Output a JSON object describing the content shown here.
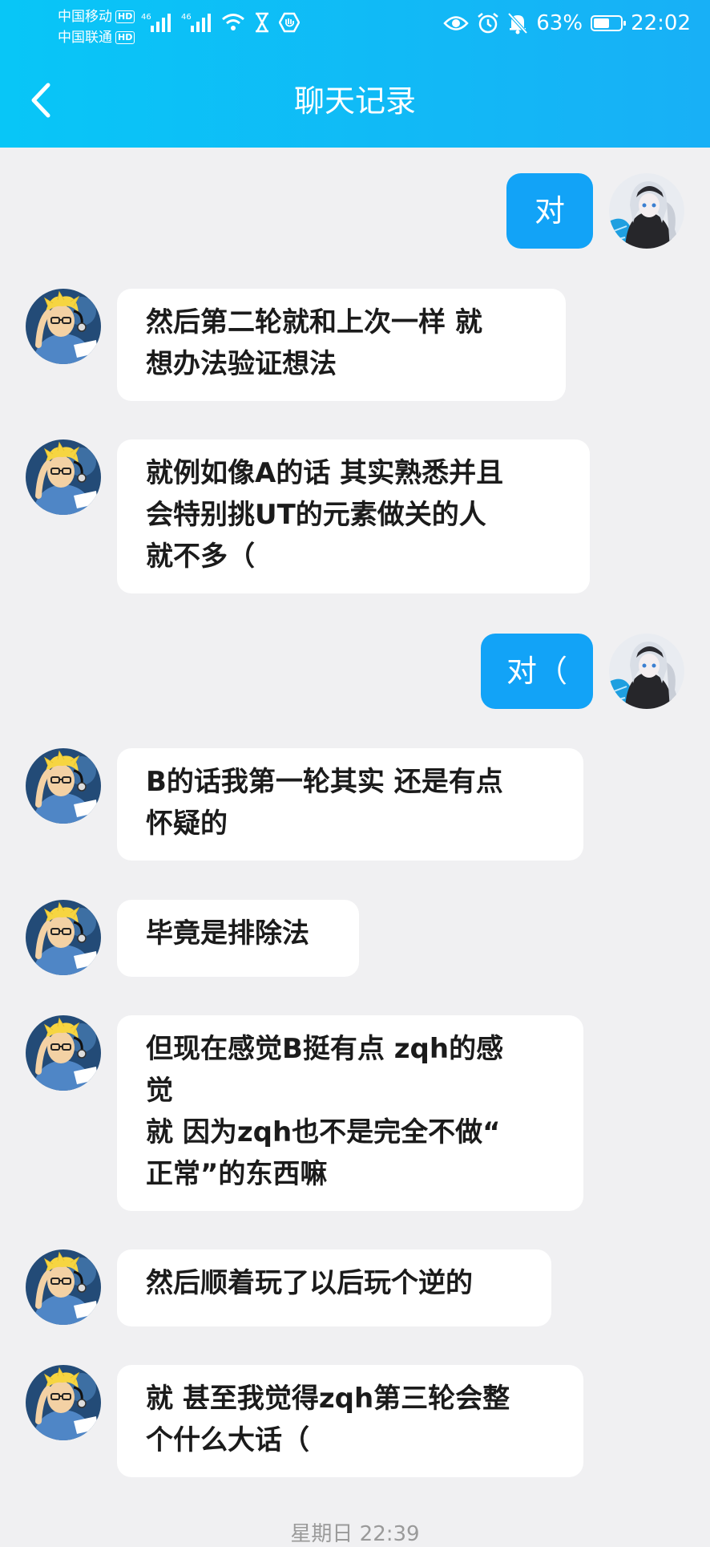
{
  "status_bar": {
    "carrier1": "中国移动",
    "carrier2": "中国联通",
    "hd": "HD",
    "net1": "46",
    "net2": "46",
    "battery_pct": "63%",
    "battery_level": 0.63,
    "time": "22:02"
  },
  "header": {
    "title": "聊天记录"
  },
  "colors": {
    "accent": "#12a3f7",
    "header": "#08c6f7"
  },
  "messages": [
    {
      "side": "right",
      "text": "对"
    },
    {
      "side": "left",
      "text": "然后第二轮就和上次一样 就\n想办法验证想法"
    },
    {
      "side": "left",
      "text": "就例如像A的话 其实熟悉并且\n会特别挑UT的元素做关的人\n就不多（"
    },
    {
      "side": "right",
      "text": "对（"
    },
    {
      "side": "left",
      "text": "B的话我第一轮其实 还是有点\n怀疑的"
    },
    {
      "side": "left",
      "text": "毕竟是排除法"
    },
    {
      "side": "left",
      "text": "但现在感觉B挺有点 zqh的感\n觉\n就 因为zqh也不是完全不做“\n正常”的东西嘛"
    },
    {
      "side": "left",
      "text": "然后顺着玩了以后玩个逆的"
    },
    {
      "side": "left",
      "text": "就 甚至我觉得zqh第三轮会整\n个什么大话（"
    }
  ],
  "timestamp": "星期日 22:39"
}
